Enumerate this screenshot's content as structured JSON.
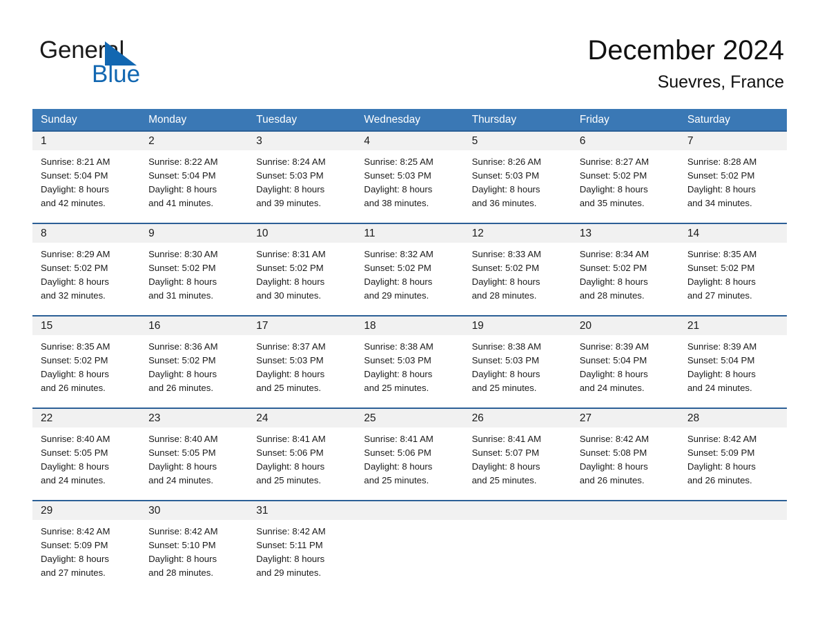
{
  "brand": {
    "name_part1": "General",
    "name_part2": "Blue",
    "accent_color": "#1267b1"
  },
  "header": {
    "title": "December 2024",
    "subtitle": "Suevres, France"
  },
  "theme": {
    "header_row_bg": "#3a78b5",
    "week_divider": "#2b5f96",
    "daynum_band": "#f1f1f1"
  },
  "weekdays": [
    "Sunday",
    "Monday",
    "Tuesday",
    "Wednesday",
    "Thursday",
    "Friday",
    "Saturday"
  ],
  "weeks": [
    [
      {
        "day": "1",
        "sunrise": "Sunrise: 8:21 AM",
        "sunset": "Sunset: 5:04 PM",
        "daylight_line1": "Daylight: 8 hours",
        "daylight_line2": "and 42 minutes."
      },
      {
        "day": "2",
        "sunrise": "Sunrise: 8:22 AM",
        "sunset": "Sunset: 5:04 PM",
        "daylight_line1": "Daylight: 8 hours",
        "daylight_line2": "and 41 minutes."
      },
      {
        "day": "3",
        "sunrise": "Sunrise: 8:24 AM",
        "sunset": "Sunset: 5:03 PM",
        "daylight_line1": "Daylight: 8 hours",
        "daylight_line2": "and 39 minutes."
      },
      {
        "day": "4",
        "sunrise": "Sunrise: 8:25 AM",
        "sunset": "Sunset: 5:03 PM",
        "daylight_line1": "Daylight: 8 hours",
        "daylight_line2": "and 38 minutes."
      },
      {
        "day": "5",
        "sunrise": "Sunrise: 8:26 AM",
        "sunset": "Sunset: 5:03 PM",
        "daylight_line1": "Daylight: 8 hours",
        "daylight_line2": "and 36 minutes."
      },
      {
        "day": "6",
        "sunrise": "Sunrise: 8:27 AM",
        "sunset": "Sunset: 5:02 PM",
        "daylight_line1": "Daylight: 8 hours",
        "daylight_line2": "and 35 minutes."
      },
      {
        "day": "7",
        "sunrise": "Sunrise: 8:28 AM",
        "sunset": "Sunset: 5:02 PM",
        "daylight_line1": "Daylight: 8 hours",
        "daylight_line2": "and 34 minutes."
      }
    ],
    [
      {
        "day": "8",
        "sunrise": "Sunrise: 8:29 AM",
        "sunset": "Sunset: 5:02 PM",
        "daylight_line1": "Daylight: 8 hours",
        "daylight_line2": "and 32 minutes."
      },
      {
        "day": "9",
        "sunrise": "Sunrise: 8:30 AM",
        "sunset": "Sunset: 5:02 PM",
        "daylight_line1": "Daylight: 8 hours",
        "daylight_line2": "and 31 minutes."
      },
      {
        "day": "10",
        "sunrise": "Sunrise: 8:31 AM",
        "sunset": "Sunset: 5:02 PM",
        "daylight_line1": "Daylight: 8 hours",
        "daylight_line2": "and 30 minutes."
      },
      {
        "day": "11",
        "sunrise": "Sunrise: 8:32 AM",
        "sunset": "Sunset: 5:02 PM",
        "daylight_line1": "Daylight: 8 hours",
        "daylight_line2": "and 29 minutes."
      },
      {
        "day": "12",
        "sunrise": "Sunrise: 8:33 AM",
        "sunset": "Sunset: 5:02 PM",
        "daylight_line1": "Daylight: 8 hours",
        "daylight_line2": "and 28 minutes."
      },
      {
        "day": "13",
        "sunrise": "Sunrise: 8:34 AM",
        "sunset": "Sunset: 5:02 PM",
        "daylight_line1": "Daylight: 8 hours",
        "daylight_line2": "and 28 minutes."
      },
      {
        "day": "14",
        "sunrise": "Sunrise: 8:35 AM",
        "sunset": "Sunset: 5:02 PM",
        "daylight_line1": "Daylight: 8 hours",
        "daylight_line2": "and 27 minutes."
      }
    ],
    [
      {
        "day": "15",
        "sunrise": "Sunrise: 8:35 AM",
        "sunset": "Sunset: 5:02 PM",
        "daylight_line1": "Daylight: 8 hours",
        "daylight_line2": "and 26 minutes."
      },
      {
        "day": "16",
        "sunrise": "Sunrise: 8:36 AM",
        "sunset": "Sunset: 5:02 PM",
        "daylight_line1": "Daylight: 8 hours",
        "daylight_line2": "and 26 minutes."
      },
      {
        "day": "17",
        "sunrise": "Sunrise: 8:37 AM",
        "sunset": "Sunset: 5:03 PM",
        "daylight_line1": "Daylight: 8 hours",
        "daylight_line2": "and 25 minutes."
      },
      {
        "day": "18",
        "sunrise": "Sunrise: 8:38 AM",
        "sunset": "Sunset: 5:03 PM",
        "daylight_line1": "Daylight: 8 hours",
        "daylight_line2": "and 25 minutes."
      },
      {
        "day": "19",
        "sunrise": "Sunrise: 8:38 AM",
        "sunset": "Sunset: 5:03 PM",
        "daylight_line1": "Daylight: 8 hours",
        "daylight_line2": "and 25 minutes."
      },
      {
        "day": "20",
        "sunrise": "Sunrise: 8:39 AM",
        "sunset": "Sunset: 5:04 PM",
        "daylight_line1": "Daylight: 8 hours",
        "daylight_line2": "and 24 minutes."
      },
      {
        "day": "21",
        "sunrise": "Sunrise: 8:39 AM",
        "sunset": "Sunset: 5:04 PM",
        "daylight_line1": "Daylight: 8 hours",
        "daylight_line2": "and 24 minutes."
      }
    ],
    [
      {
        "day": "22",
        "sunrise": "Sunrise: 8:40 AM",
        "sunset": "Sunset: 5:05 PM",
        "daylight_line1": "Daylight: 8 hours",
        "daylight_line2": "and 24 minutes."
      },
      {
        "day": "23",
        "sunrise": "Sunrise: 8:40 AM",
        "sunset": "Sunset: 5:05 PM",
        "daylight_line1": "Daylight: 8 hours",
        "daylight_line2": "and 24 minutes."
      },
      {
        "day": "24",
        "sunrise": "Sunrise: 8:41 AM",
        "sunset": "Sunset: 5:06 PM",
        "daylight_line1": "Daylight: 8 hours",
        "daylight_line2": "and 25 minutes."
      },
      {
        "day": "25",
        "sunrise": "Sunrise: 8:41 AM",
        "sunset": "Sunset: 5:06 PM",
        "daylight_line1": "Daylight: 8 hours",
        "daylight_line2": "and 25 minutes."
      },
      {
        "day": "26",
        "sunrise": "Sunrise: 8:41 AM",
        "sunset": "Sunset: 5:07 PM",
        "daylight_line1": "Daylight: 8 hours",
        "daylight_line2": "and 25 minutes."
      },
      {
        "day": "27",
        "sunrise": "Sunrise: 8:42 AM",
        "sunset": "Sunset: 5:08 PM",
        "daylight_line1": "Daylight: 8 hours",
        "daylight_line2": "and 26 minutes."
      },
      {
        "day": "28",
        "sunrise": "Sunrise: 8:42 AM",
        "sunset": "Sunset: 5:09 PM",
        "daylight_line1": "Daylight: 8 hours",
        "daylight_line2": "and 26 minutes."
      }
    ],
    [
      {
        "day": "29",
        "sunrise": "Sunrise: 8:42 AM",
        "sunset": "Sunset: 5:09 PM",
        "daylight_line1": "Daylight: 8 hours",
        "daylight_line2": "and 27 minutes."
      },
      {
        "day": "30",
        "sunrise": "Sunrise: 8:42 AM",
        "sunset": "Sunset: 5:10 PM",
        "daylight_line1": "Daylight: 8 hours",
        "daylight_line2": "and 28 minutes."
      },
      {
        "day": "31",
        "sunrise": "Sunrise: 8:42 AM",
        "sunset": "Sunset: 5:11 PM",
        "daylight_line1": "Daylight: 8 hours",
        "daylight_line2": "and 29 minutes."
      },
      {
        "day": "",
        "sunrise": "",
        "sunset": "",
        "daylight_line1": "",
        "daylight_line2": ""
      },
      {
        "day": "",
        "sunrise": "",
        "sunset": "",
        "daylight_line1": "",
        "daylight_line2": ""
      },
      {
        "day": "",
        "sunrise": "",
        "sunset": "",
        "daylight_line1": "",
        "daylight_line2": ""
      },
      {
        "day": "",
        "sunrise": "",
        "sunset": "",
        "daylight_line1": "",
        "daylight_line2": ""
      }
    ]
  ]
}
